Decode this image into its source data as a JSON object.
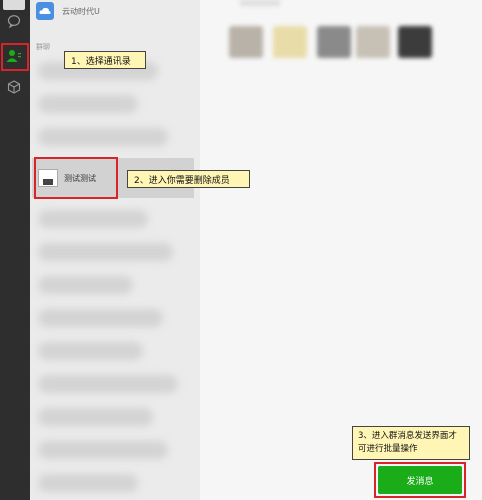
{
  "sidebar": {
    "icons": [
      "chat-icon",
      "contacts-icon",
      "cube-icon"
    ],
    "active": "contacts-icon"
  },
  "contacts": {
    "top_item": "云动时代U",
    "section_letter": "群聊",
    "selected_contact": "测试测试"
  },
  "callouts": {
    "step1": "1、选择通讯录",
    "step2": "2、进入你需要删除成员",
    "step3": "3、进入群消息发送界面才可进行批量操作"
  },
  "main": {
    "send_button": "发消息"
  },
  "colors": {
    "highlight_border": "#d9232a",
    "callout_bg": "#fff5b5",
    "send_button": "#1aad19",
    "sidebar_bg": "#2e2e2e"
  }
}
